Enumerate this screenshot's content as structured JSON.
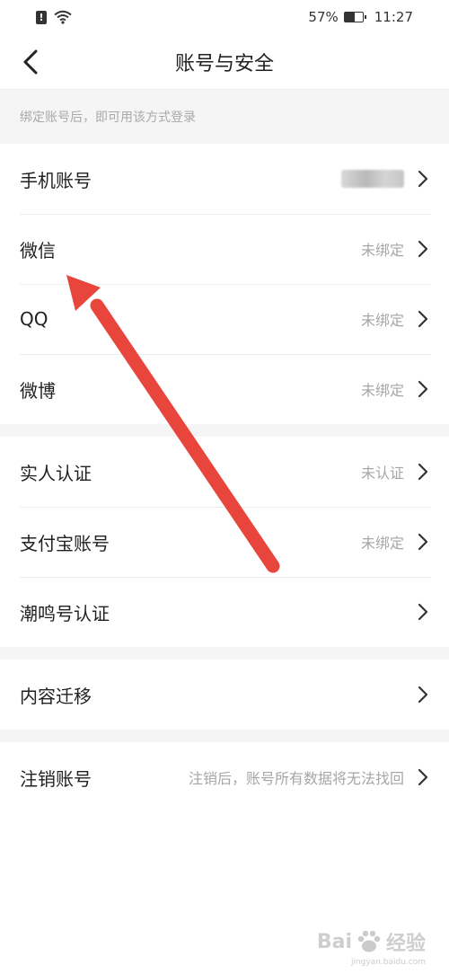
{
  "status_bar": {
    "battery_percent": "57%",
    "battery_level": 0.57,
    "time": "11:27",
    "icons": [
      "alert-icon",
      "wifi-icon",
      "battery-icon"
    ]
  },
  "header": {
    "title": "账号与安全",
    "back_icon": "chevron-left-icon"
  },
  "hint": "绑定账号后，即可用该方式登录",
  "groups": [
    {
      "items": [
        {
          "label": "手机账号",
          "value": ""
        },
        {
          "label": "微信",
          "value": "未绑定"
        },
        {
          "label": "QQ",
          "value": "未绑定"
        },
        {
          "label": "微博",
          "value": "未绑定"
        }
      ]
    },
    {
      "items": [
        {
          "label": "实人认证",
          "value": "未认证"
        },
        {
          "label": "支付宝账号",
          "value": "未绑定"
        },
        {
          "label": "潮鸣号认证",
          "value": ""
        }
      ]
    },
    {
      "items": [
        {
          "label": "内容迁移",
          "value": ""
        }
      ]
    },
    {
      "items": [
        {
          "label": "注销账号",
          "value": "注销后，账号所有数据将无法找回"
        }
      ]
    }
  ],
  "annotation": {
    "color": "#e8453c"
  },
  "watermark": {
    "text": "Bai",
    "text2": "经验",
    "sub": "jingyan.baidu.com"
  }
}
